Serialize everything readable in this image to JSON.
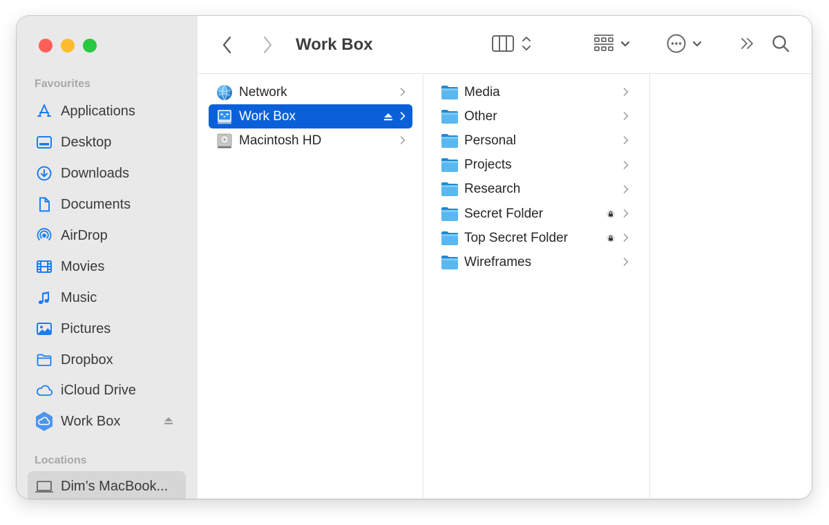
{
  "window": {
    "traffic_lights": [
      "close",
      "minimize",
      "zoom"
    ],
    "colors": {
      "close": "#fe5f57",
      "minimize": "#febc2e",
      "zoom": "#28c840",
      "accent": "#0a60d9",
      "sidebar_icon": "#1a7cf5"
    }
  },
  "toolbar": {
    "title": "Work Box",
    "back_icon": "chevron-left-icon",
    "forward_icon": "chevron-right-icon",
    "view_icon": "column-view-icon",
    "group_icon": "group-by-icon",
    "action_icon": "ellipsis-circle-icon",
    "overflow_icon": "double-chevron-right-icon",
    "search_icon": "search-icon"
  },
  "sidebar": {
    "favourites_label": "Favourites",
    "favourites": [
      {
        "label": "Applications",
        "icon": "applications-icon"
      },
      {
        "label": "Desktop",
        "icon": "desktop-icon"
      },
      {
        "label": "Downloads",
        "icon": "downloads-icon"
      },
      {
        "label": "Documents",
        "icon": "documents-icon"
      },
      {
        "label": "AirDrop",
        "icon": "airdrop-icon"
      },
      {
        "label": "Movies",
        "icon": "movies-icon"
      },
      {
        "label": "Music",
        "icon": "music-icon"
      },
      {
        "label": "Pictures",
        "icon": "pictures-icon"
      },
      {
        "label": "Dropbox",
        "icon": "folder-icon"
      },
      {
        "label": "iCloud Drive",
        "icon": "icloud-icon"
      },
      {
        "label": "Work Box",
        "icon": "workbox-icon",
        "ejectable": true
      }
    ],
    "locations_label": "Locations",
    "locations": [
      {
        "label": "Dim’s MacBook...",
        "icon": "laptop-icon",
        "selected": true
      }
    ]
  },
  "columns": {
    "col1": [
      {
        "label": "Network",
        "icon": "network-icon"
      },
      {
        "label": "Work Box",
        "icon": "workbox-drive-icon",
        "selected": true,
        "ejectable": true
      },
      {
        "label": "Macintosh HD",
        "icon": "hard-drive-icon"
      }
    ],
    "col2": [
      {
        "label": "Media",
        "locked": false
      },
      {
        "label": "Other",
        "locked": false
      },
      {
        "label": "Personal",
        "locked": false
      },
      {
        "label": "Projects",
        "locked": false
      },
      {
        "label": "Research",
        "locked": false
      },
      {
        "label": "Secret Folder",
        "locked": true
      },
      {
        "label": "Top Secret Folder",
        "locked": true
      },
      {
        "label": "Wireframes",
        "locked": false
      }
    ]
  }
}
